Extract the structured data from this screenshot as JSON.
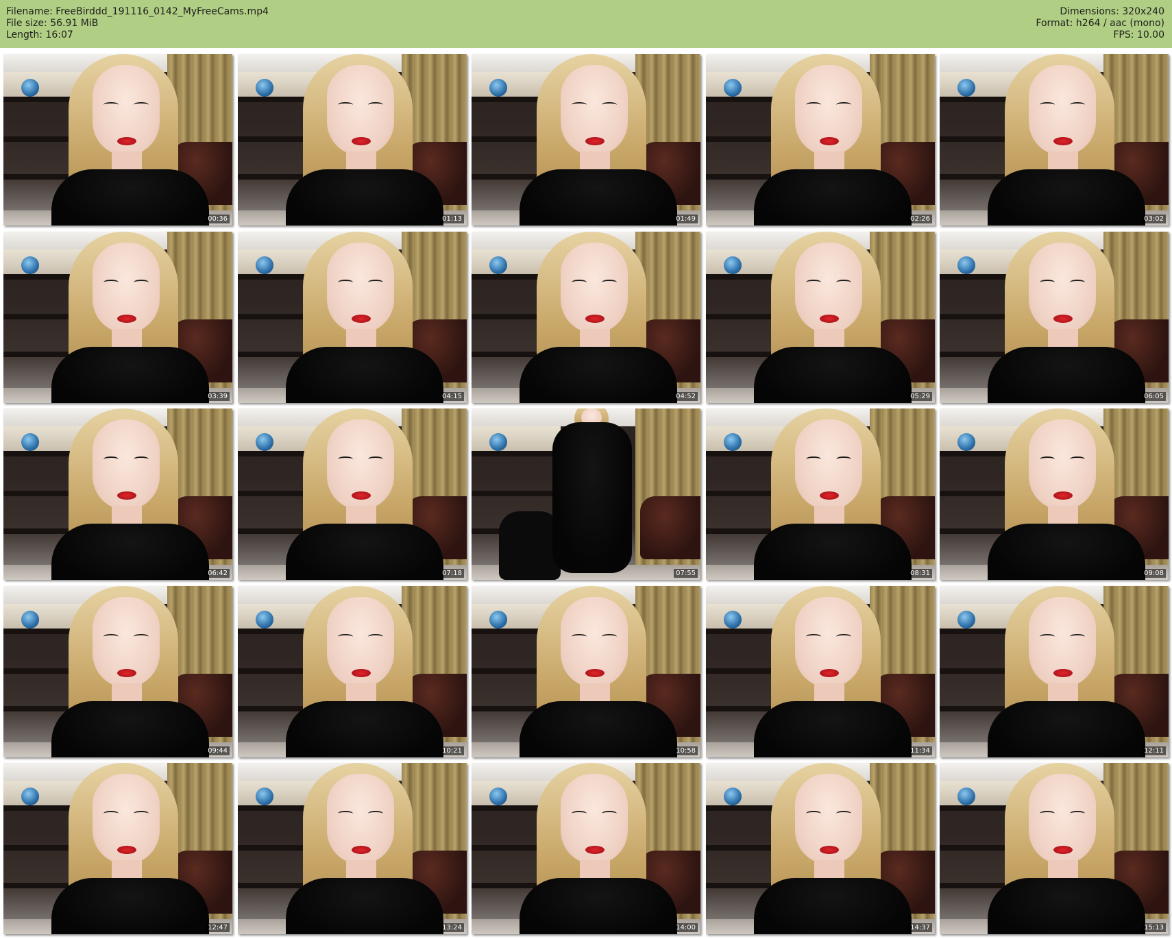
{
  "header": {
    "filename_line": "Filename: FreeBirddd_191116_0142_MyFreeCams.mp4",
    "filesize_line": "File size: 56.91 MiB",
    "length_line": "Length: 16:07",
    "dimensions_line": "Dimensions: 320x240",
    "format_line": "Format: h264 / aac (mono)",
    "fps_line": "FPS: 10.00"
  },
  "colors": {
    "header_bg": "#b1cf84",
    "page_bg": "#ffffff"
  },
  "thumbnails": [
    {
      "time": "00:36"
    },
    {
      "time": "01:13"
    },
    {
      "time": "01:49"
    },
    {
      "time": "02:26"
    },
    {
      "time": "03:02"
    },
    {
      "time": "03:39"
    },
    {
      "time": "04:15"
    },
    {
      "time": "04:52"
    },
    {
      "time": "05:29"
    },
    {
      "time": "06:05"
    },
    {
      "time": "06:42"
    },
    {
      "time": "07:18"
    },
    {
      "time": "07:55"
    },
    {
      "time": "08:31"
    },
    {
      "time": "09:08"
    },
    {
      "time": "09:44"
    },
    {
      "time": "10:21"
    },
    {
      "time": "10:58"
    },
    {
      "time": "11:34"
    },
    {
      "time": "12:11"
    },
    {
      "time": "12:47"
    },
    {
      "time": "13:24"
    },
    {
      "time": "14:00"
    },
    {
      "time": "14:37"
    },
    {
      "time": "15:13"
    }
  ]
}
